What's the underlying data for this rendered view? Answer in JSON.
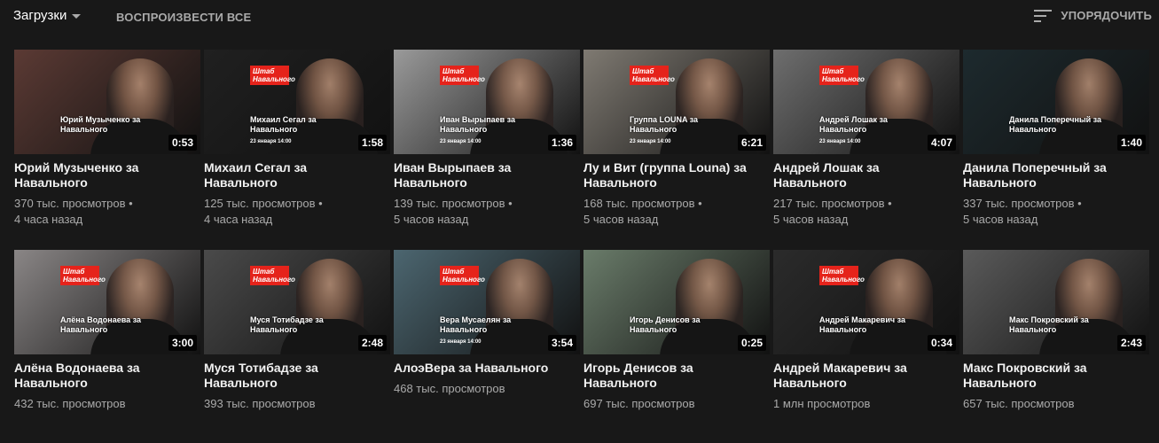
{
  "header": {
    "playlist_label": "Загрузки",
    "play_all_label": "ВОСПРОИЗВЕСТИ ВСЕ",
    "sort_label": "УПОРЯДОЧИТЬ",
    "sort_icon": "sort-icon",
    "dropdown_icon": "chevron-down-icon"
  },
  "thumbnail_brand": "Штаб Навального",
  "videos": [
    {
      "title": "Юрий Музыченко за Навального",
      "views": "370 тыс. просмотров",
      "age": "4 часа назад",
      "duration": "0:53",
      "overlay": "Юрий Музыченко за Навального",
      "date": "",
      "brand": false,
      "bg": "#5b3a34"
    },
    {
      "title": "Михаил Сегал за Навального",
      "views": "125 тыс. просмотров",
      "age": "4 часа назад",
      "duration": "1:58",
      "overlay": "Михаил Сегал за Навального",
      "date": "23 января 14:00",
      "brand": true,
      "bg": "#202020"
    },
    {
      "title": "Иван Вырыпаев за Навального",
      "views": "139 тыс. просмотров",
      "age": "5 часов назад",
      "duration": "1:36",
      "overlay": "Иван Вырыпаев за Навального",
      "date": "23 января 14:00",
      "brand": true,
      "bg": "#9a9a9a"
    },
    {
      "title": "Лу и Вит (группа Louna) за Навального",
      "views": "168 тыс. просмотров",
      "age": "5 часов назад",
      "duration": "6:21",
      "overlay": "Группа LOUNA за Навального",
      "date": "23 января 14:00",
      "brand": true,
      "bg": "#7f7a72"
    },
    {
      "title": "Андрей Лошак за Навального",
      "views": "217 тыс. просмотров",
      "age": "5 часов назад",
      "duration": "4:07",
      "overlay": "Андрей Лошак за Навального",
      "date": "23 января 14:00",
      "brand": true,
      "bg": "#6e6e6e"
    },
    {
      "title": "Данила Поперечный за Навального",
      "views": "337 тыс. просмотров",
      "age": "5 часов назад",
      "duration": "1:40",
      "overlay": "Данила Поперечный за Навального",
      "date": "",
      "brand": false,
      "bg": "#1d2a2e"
    },
    {
      "title": "Алёна Водонаева за Навального",
      "views": "432 тыс. просмотров",
      "age": "",
      "duration": "3:00",
      "overlay": "Алёна Водонаева за Навального",
      "date": "",
      "brand": true,
      "bg": "#8a8686"
    },
    {
      "title": "Муся Тотибадзе за Навального",
      "views": "393 тыс. просмотров",
      "age": "",
      "duration": "2:48",
      "overlay": "Муся Тотибадзе за Навального",
      "date": "",
      "brand": true,
      "bg": "#4a4a4a"
    },
    {
      "title": "АлоэВера за Навального",
      "views": "468 тыс. просмотров",
      "age": "",
      "duration": "3:54",
      "overlay": "Вера Мусаелян за Навального",
      "date": "23 января 14:00",
      "brand": true,
      "bg": "#4c6670"
    },
    {
      "title": "Игорь Денисов за Навального",
      "views": "697 тыс. просмотров",
      "age": "",
      "duration": "0:25",
      "overlay": "Игорь Денисов за Навального",
      "date": "",
      "brand": false,
      "bg": "#6a7c6a"
    },
    {
      "title": "Андрей Макаревич за Навального",
      "views": "1 млн просмотров",
      "age": "",
      "duration": "0:34",
      "overlay": "Андрей Макаревич за Навального",
      "date": "",
      "brand": true,
      "bg": "#2b2b2b"
    },
    {
      "title": "Макс Покровский за Навального",
      "views": "657 тыс. просмотров",
      "age": "",
      "duration": "2:43",
      "overlay": "Макс Покровский за Навального",
      "date": "",
      "brand": false,
      "bg": "#5a5a5a"
    }
  ]
}
